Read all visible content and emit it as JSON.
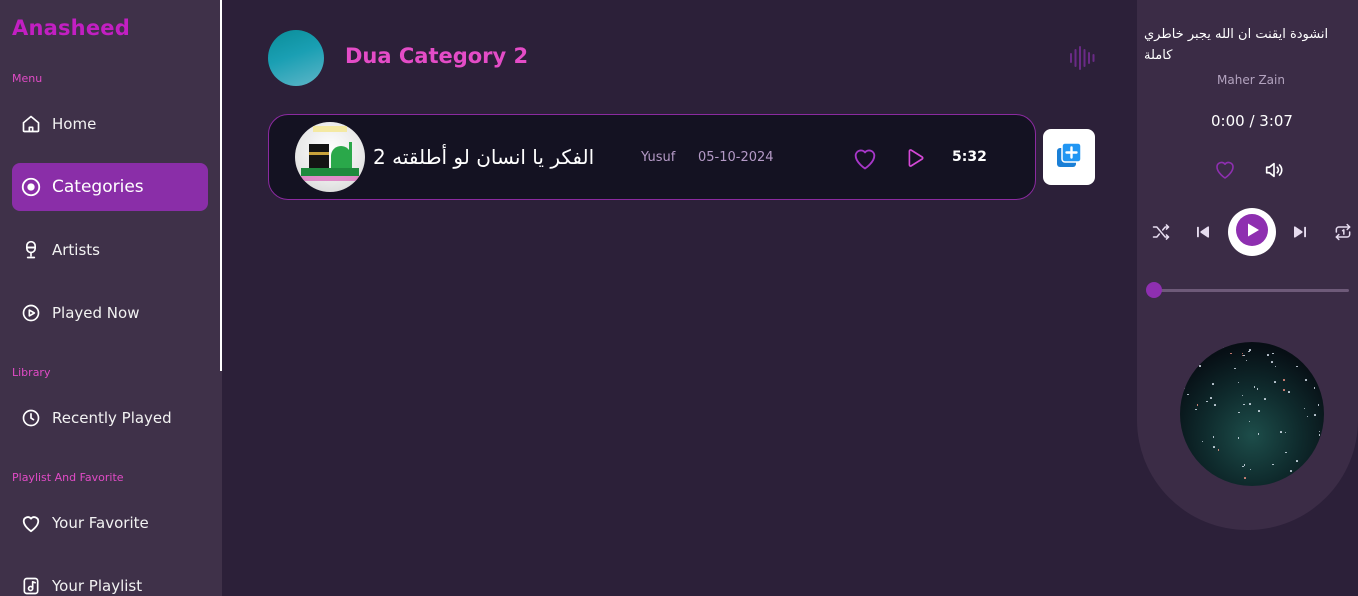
{
  "app": {
    "brand": "Anasheed",
    "colors": {
      "accent": "#8a2ea8",
      "brand": "#c21fc2",
      "title_pink": "#e44cc7",
      "background": "#2c2039",
      "sidebar": "#3f3149"
    }
  },
  "sidebar": {
    "sections": {
      "menu": "Menu",
      "library": "Library",
      "playlist": "Playlist And Favorite"
    },
    "items": [
      {
        "label": "Home",
        "icon": "home-icon"
      },
      {
        "label": "Categories",
        "icon": "categories-icon",
        "active": true
      },
      {
        "label": "Artists",
        "icon": "microphone-icon"
      },
      {
        "label": "Played Now",
        "icon": "play-circle-icon"
      },
      {
        "label": "Recently Played",
        "icon": "clock-icon"
      },
      {
        "label": "Your Favorite",
        "icon": "heart-icon"
      },
      {
        "label": "Your Playlist",
        "icon": "music-file-icon"
      }
    ]
  },
  "main": {
    "category_title": "Dua Category 2",
    "tracks": [
      {
        "title": "الفكر يا انسان لو أطلقته 2",
        "artist": "Yusuf",
        "date": "05-10-2024",
        "duration": "5:32"
      }
    ]
  },
  "player": {
    "title": "انشودة ايقنت ان الله يجبر خاطري كاملة",
    "artist": "Maher Zain",
    "time": "0:00 / 3:07",
    "progress": 0
  }
}
